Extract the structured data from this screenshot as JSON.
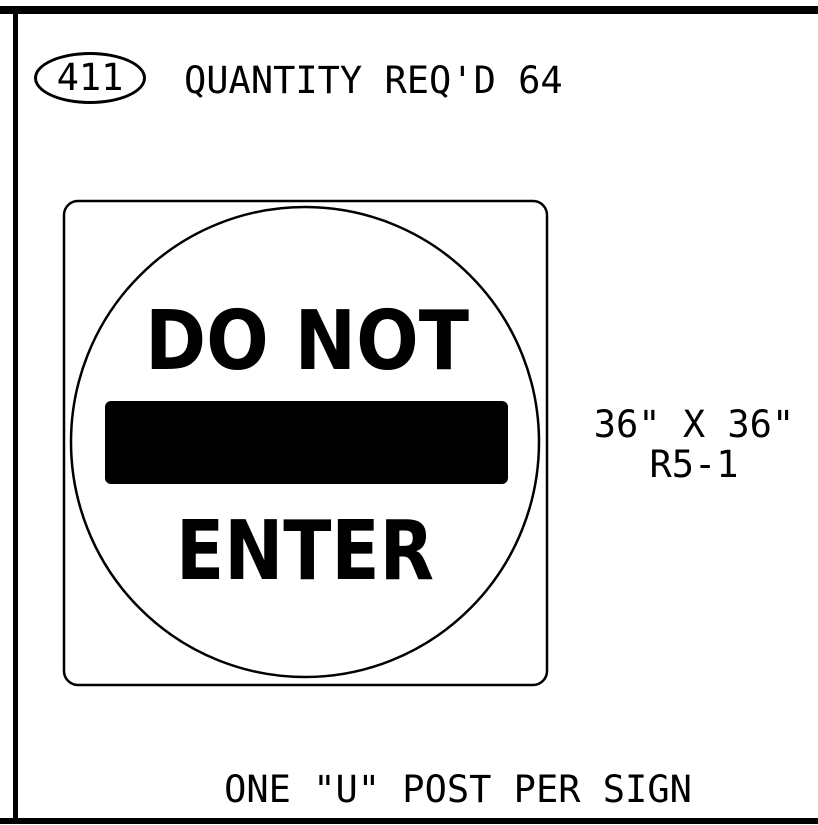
{
  "sign": {
    "number": "411",
    "quantity_text": "QUANTITY REQ'D 64",
    "legend_top": "DO NOT",
    "legend_bottom": "ENTER",
    "size": "36\" X 36\"",
    "code": "R5-1"
  },
  "footer": {
    "note": "ONE \"U\" POST PER SIGN"
  },
  "colors": {
    "ink": "#000000",
    "background": "#ffffff"
  }
}
